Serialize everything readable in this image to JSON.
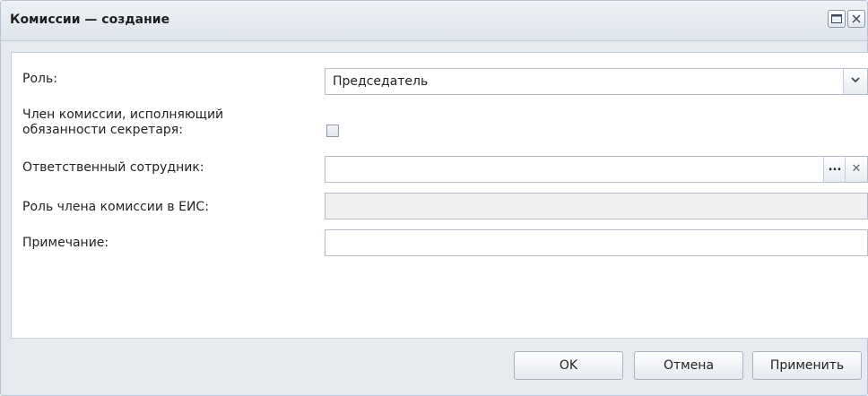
{
  "window": {
    "title": "Комиссии — создание",
    "maximize_icon": "maximize-icon",
    "close_icon": "close-icon"
  },
  "form": {
    "role": {
      "label": "Роль:",
      "value": "Председатель"
    },
    "secretary": {
      "label_line1": "Член комиссии, исполняющий",
      "label_line2": "обязанности секретаря:",
      "checked": false
    },
    "employee": {
      "label": "Ответственный сотрудник:",
      "value": "",
      "select_label": "...",
      "clear_label": "✕"
    },
    "eis_role": {
      "label": "Роль члена комиссии в ЕИС:",
      "value": ""
    },
    "note": {
      "label": "Примечание:",
      "value": ""
    }
  },
  "footer": {
    "ok_label": "OK",
    "cancel_label": "Отмена",
    "apply_label": "Применить"
  },
  "colors": {
    "window_bg": "#e7ebf0",
    "border": "#b7c3d1",
    "panel_bg": "#ffffff"
  }
}
